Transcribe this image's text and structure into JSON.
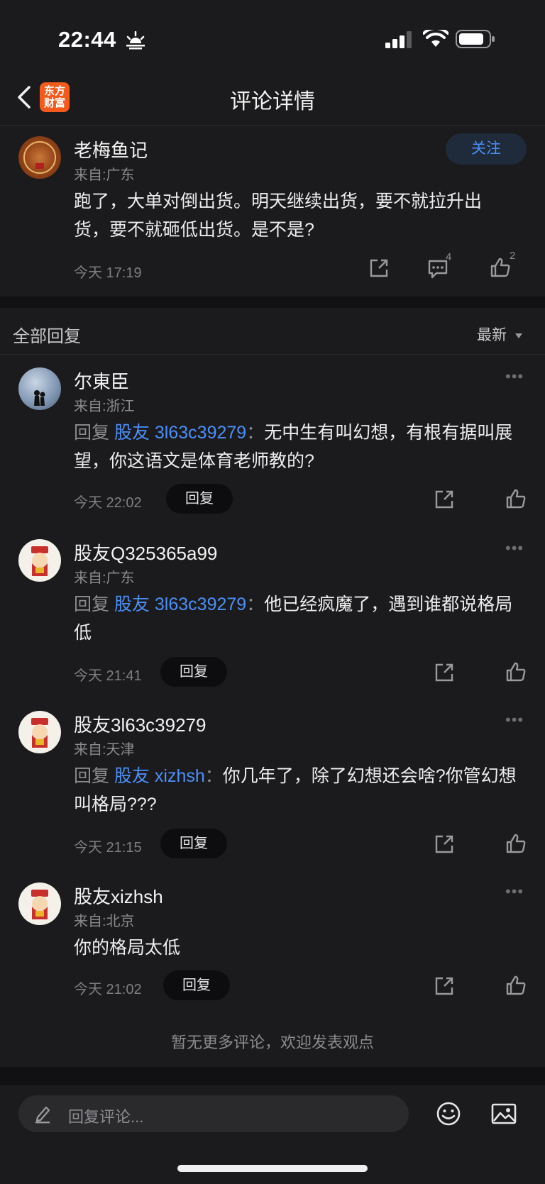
{
  "status": {
    "time": "22:44"
  },
  "nav": {
    "title": "评论详情",
    "logo_line1": "东方",
    "logo_line2": "财富"
  },
  "post": {
    "user": "老梅鱼记",
    "location": "来自:广东",
    "follow_label": "关注",
    "content": "跑了，大单对倒出货。明天继续出货，要不就拉升出货，要不就砸低出货。是不是?",
    "time": "今天 17:19",
    "comment_count": "4",
    "like_count": "2"
  },
  "replies_header": {
    "title": "全部回复",
    "sort": "最新"
  },
  "replies": [
    {
      "user": "尔東臣",
      "location": "来自:浙江",
      "prefix": "回复 ",
      "target": "股友 3l63c39279",
      "colon": "：",
      "text": "无中生有叫幻想，有根有据叫展望，你这语文是体育老师教的?",
      "time": "今天 22:02",
      "reply_label": "回复"
    },
    {
      "user": "股友Q325365a99",
      "location": "来自:广东",
      "prefix": "回复 ",
      "target": "股友 3l63c39279",
      "colon": "：",
      "text": "他已经疯魔了，遇到谁都说格局低",
      "time": "今天 21:41",
      "reply_label": "回复"
    },
    {
      "user": "股友3l63c39279",
      "location": "来自:天津",
      "prefix": "回复 ",
      "target": "股友 xizhsh",
      "colon": "：",
      "text": "你几年了，除了幻想还会啥?你管幻想叫格局???",
      "time": "今天 21:15",
      "reply_label": "回复"
    },
    {
      "user": "股友xizhsh",
      "location": "来自:北京",
      "text": "你的格局太低",
      "time": "今天 21:02",
      "reply_label": "回复"
    }
  ],
  "footer_note": "暂无更多评论，欢迎发表观点",
  "bottom": {
    "placeholder": "回复评论..."
  }
}
